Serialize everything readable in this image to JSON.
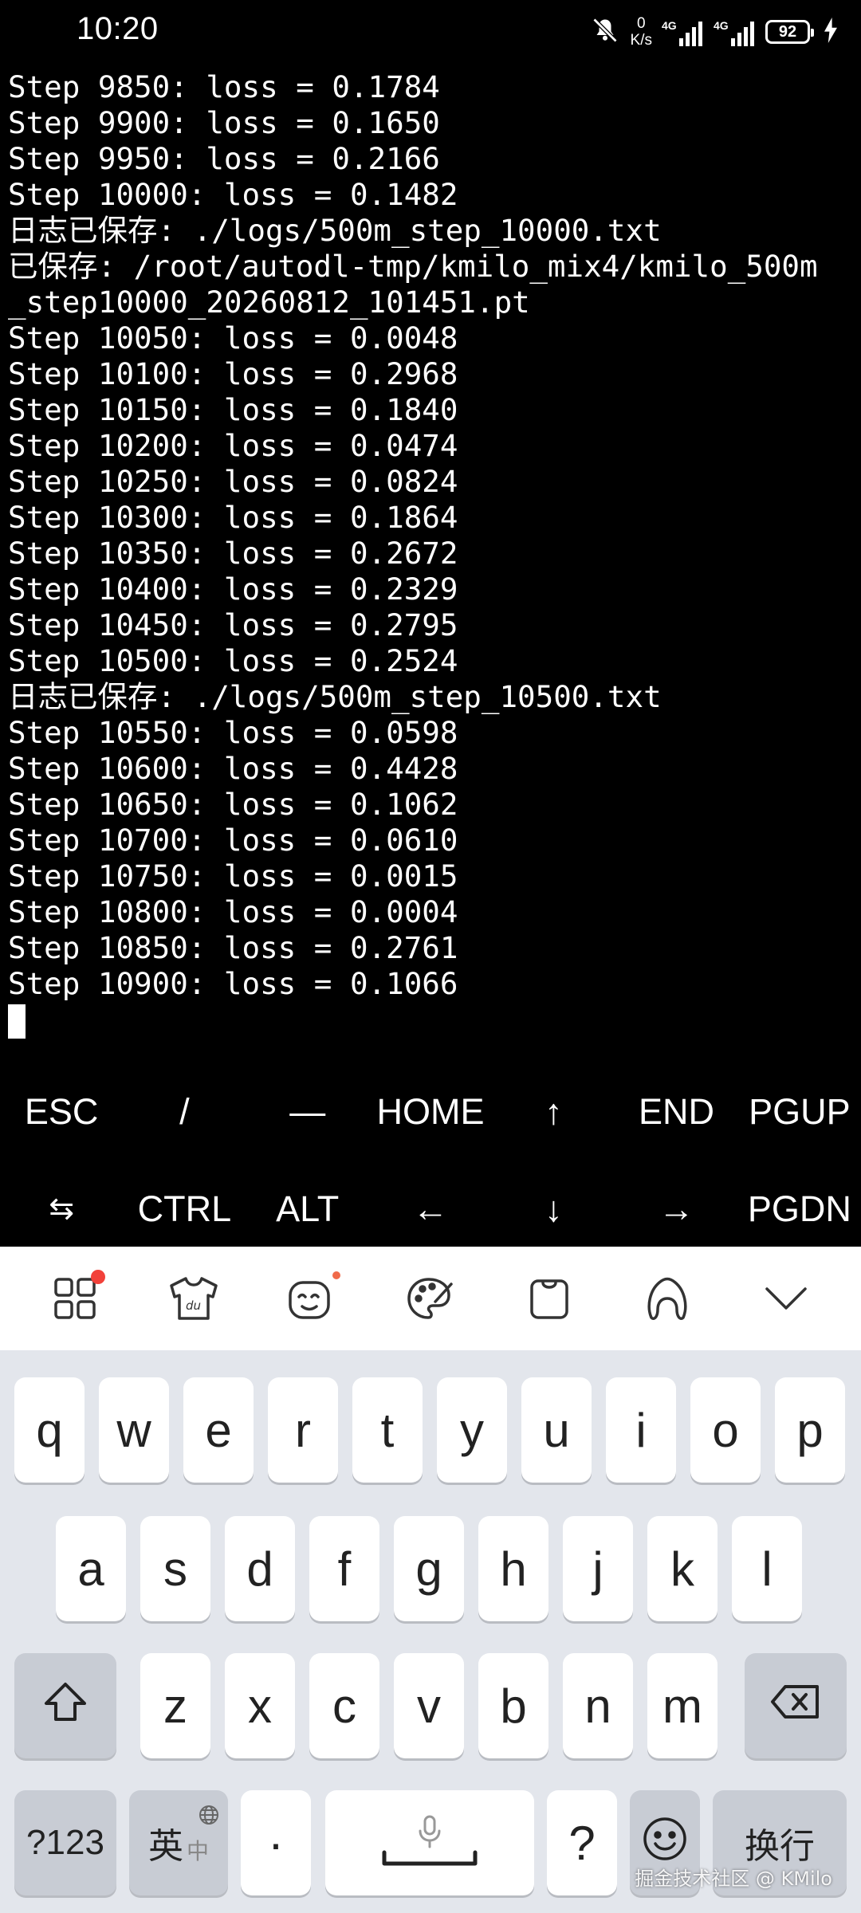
{
  "status_bar": {
    "time": "10:20",
    "net_speed_value": "0",
    "net_speed_unit": "K/s",
    "signal1_label": "4G",
    "signal2_label": "4G",
    "battery_level": "92"
  },
  "terminal": {
    "lines": [
      "Step 9850: loss = 0.1784",
      "Step 9900: loss = 0.1650",
      "Step 9950: loss = 0.2166",
      "Step 10000: loss = 0.1482",
      "日志已保存: ./logs/500m_step_10000.txt",
      "已保存: /root/autodl-tmp/kmilo_mix4/kmilo_500m",
      "_step10000_20260812_101451.pt",
      "Step 10050: loss = 0.0048",
      "Step 10100: loss = 0.2968",
      "Step 10150: loss = 0.1840",
      "Step 10200: loss = 0.0474",
      "Step 10250: loss = 0.0824",
      "Step 10300: loss = 0.1864",
      "Step 10350: loss = 0.2672",
      "Step 10400: loss = 0.2329",
      "Step 10450: loss = 0.2795",
      "Step 10500: loss = 0.2524",
      "日志已保存: ./logs/500m_step_10500.txt",
      "Step 10550: loss = 0.0598",
      "Step 10600: loss = 0.4428",
      "Step 10650: loss = 0.1062",
      "Step 10700: loss = 0.0610",
      "Step 10750: loss = 0.0015",
      "Step 10800: loss = 0.0004",
      "Step 10850: loss = 0.2761",
      "Step 10900: loss = 0.1066"
    ]
  },
  "extra_keys": {
    "row1": [
      "ESC",
      "/",
      "—",
      "HOME",
      "↑",
      "END",
      "PGUP"
    ],
    "row2": [
      "⇆",
      "CTRL",
      "ALT",
      "←",
      "↓",
      "→",
      "PGDN"
    ]
  },
  "ime_toolbar": {
    "icons": [
      "apps-grid-icon",
      "skin-shirt-icon",
      "emoji-sticker-icon",
      "palette-icon",
      "clipboard-icon",
      "handwriting-icon",
      "collapse-chevron-icon"
    ]
  },
  "keyboard": {
    "row1": [
      "q",
      "w",
      "e",
      "r",
      "t",
      "y",
      "u",
      "i",
      "o",
      "p"
    ],
    "row2": [
      "a",
      "s",
      "d",
      "f",
      "g",
      "h",
      "j",
      "k",
      "l"
    ],
    "row3": [
      "z",
      "x",
      "c",
      "v",
      "b",
      "n",
      "m"
    ],
    "symbols_label": "?123",
    "lang_main": "英",
    "lang_alt": "中",
    "dot_label": "·",
    "question_label": "?",
    "enter_label": "换行",
    "watermark": "掘金技术社区 @ KMilo"
  },
  "colors": {
    "terminal_bg": "#000000",
    "terminal_fg": "#ffffff",
    "keyboard_bg": "#e3e6ec",
    "func_key_bg": "#c8ccd4",
    "badge_red": "#f2413a"
  }
}
